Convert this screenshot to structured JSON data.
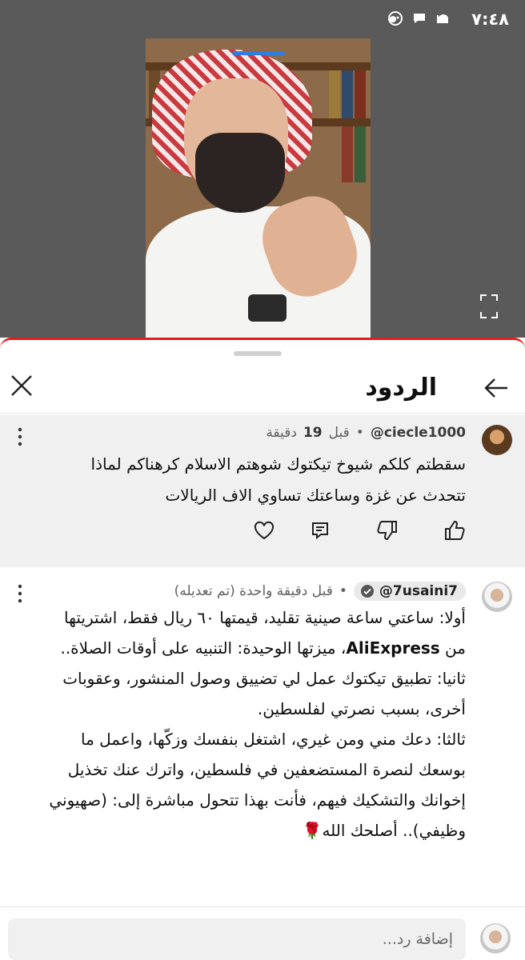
{
  "status_bar": {
    "time": "٧:٤٨",
    "icons": [
      "android-icon",
      "chat-bubble-icon",
      "mosque-icon",
      "dot-icon"
    ]
  },
  "sheet": {
    "title": "الردود"
  },
  "parent_comment": {
    "handle": "@ciecle1000",
    "time_prefix": "قبل",
    "time_number": "19",
    "time_unit": "دقيقة",
    "separator": "•",
    "text": "سقطتم كلكم شيوخ تيكتوك شوهتم الاسلام كرهناكم لماذا تتحدث عن غزة وساعتك تساوي الاف الريالات"
  },
  "reply_comment": {
    "handle": "@7usaini7",
    "separator": "•",
    "time": "قبل دقيقة واحدة (تم تعديله)",
    "text_parts": [
      "أولا: ساعتي ساعة صينية تقليد، قيمتها ٦٠ ريال فقط، اشتريتها من ",
      "AliExpress",
      "، ميزتها الوحيدة: التنبيه على أوقات الصلاة..",
      "ثانيا: تطبيق تيكتوك عمل لي تضييق وصول المنشور، وعقوبات أخرى، بسبب نصرتي لفلسطين.",
      "ثالثا: دعك مني ومن غيري، اشتغل بنفسك وزكّها، واعمل ما بوسعك لنصرة المستضعفين في فلسطين، واترك عنك تخذيل إخوانك والتشكيك فيهم، فأنت بهذا تتحول مباشرة إلى: (صهيوني وظيفي).. أصلحك الله🌹"
    ]
  },
  "add_reply": {
    "placeholder": "إضافة رد..."
  },
  "colors": {
    "status_bg": "#5a5a5a",
    "accent_red": "#e21c1c",
    "parent_bg": "#f0f0f0"
  }
}
